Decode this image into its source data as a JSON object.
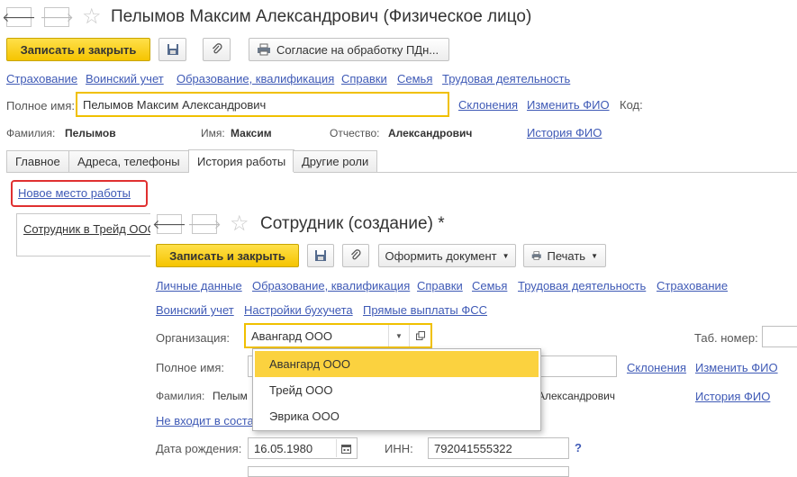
{
  "back_window": {
    "title": "Пелымов Максим Александрович (Физическое лицо)",
    "save_close": "Записать и закрыть",
    "consent_button": "Согласие на обработку ПДн...",
    "links": [
      "Страхование",
      "Воинский учет",
      "Образование, квалификация",
      "Справки",
      "Семья",
      "Трудовая деятельность"
    ],
    "full_name_label": "Полное имя:",
    "full_name_value": "Пелымов Максим Александрович",
    "declension_link": "Склонения",
    "change_fio_link": "Изменить ФИО",
    "code_label": "Код:",
    "surname_label": "Фамилия:",
    "surname_value": "Пелымов",
    "name_label": "Имя:",
    "name_value": "Максим",
    "patronymic_label": "Отчество:",
    "patronymic_value": "Александрович",
    "fio_history_link": "История ФИО",
    "tabs": [
      "Главное",
      "Адреса, телефоны",
      "История работы",
      "Другие роли"
    ],
    "new_workplace_link": "Новое место работы",
    "list_item": "Сотрудник в Трейд ООО"
  },
  "front_window": {
    "title": "Сотрудник (создание) *",
    "save_close": "Записать и закрыть",
    "create_doc_button": "Оформить документ",
    "print_button": "Печать",
    "links_row1": [
      "Личные данные",
      "Образование, квалификация",
      "Справки",
      "Семья",
      "Трудовая деятельность",
      "Страхование"
    ],
    "links_row2": [
      "Воинский учет",
      "Настройки бухучета",
      "Прямые выплаты ФСС"
    ],
    "organization_label": "Организация:",
    "organization_value": "Авангард ООО",
    "tab_number_label": "Таб. номер:",
    "full_name_label": "Полное имя:",
    "declension_link": "Склонения",
    "change_fio_link": "Изменить ФИО",
    "surname_label": "Фамилия:",
    "surname_partial": "Пелым",
    "patronymic_partial": "Александрович",
    "fio_history_link": "История ФИО",
    "not_in_staff_link": "Не входит в соста",
    "birth_date_label": "Дата рождения:",
    "birth_date_value": "16.05.1980",
    "inn_label": "ИНН:",
    "inn_value": "792041555322",
    "help_mark": "?"
  },
  "dropdown": {
    "items": [
      "Авангард ООО",
      "Трейд ООО",
      "Эврика ООО"
    ],
    "selected_index": 0
  },
  "icons": {
    "back": "arrow-left-icon",
    "forward": "arrow-right-icon",
    "favorite": "star-icon",
    "save": "floppy-disk-icon",
    "attach": "paperclip-icon",
    "print": "printer-icon",
    "calendar": "calendar-icon",
    "open": "open-window-icon"
  },
  "colors": {
    "accent_yellow": "#f5c400",
    "link_blue": "#3f5ab6",
    "highlight_red": "#e03030",
    "selected_item": "#fbd23f"
  }
}
